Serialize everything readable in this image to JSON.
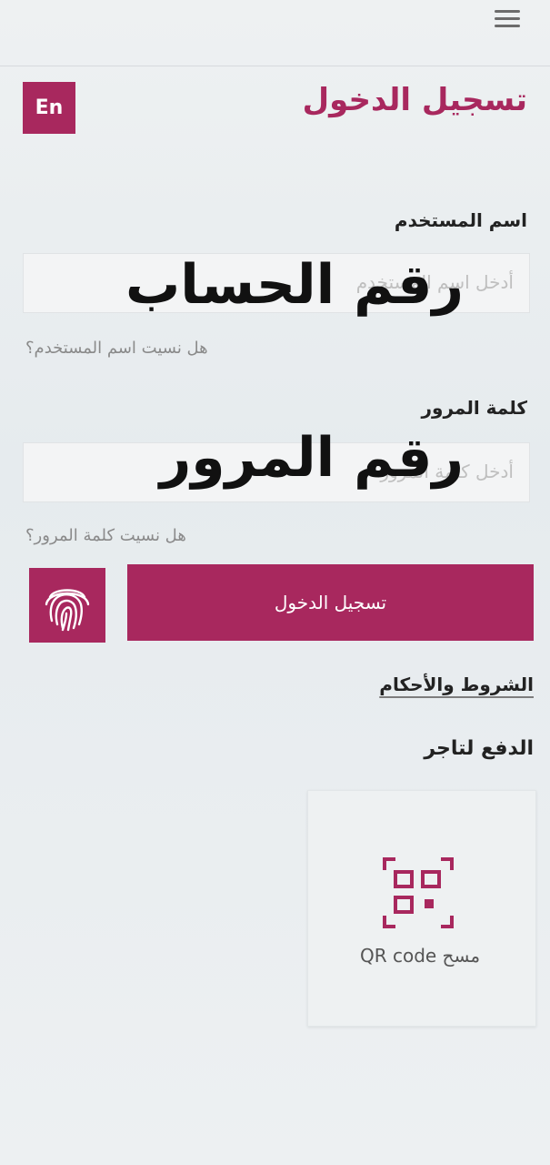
{
  "header": {
    "menu_icon": "hamburger-menu-icon",
    "title": "تسجيل الدخول",
    "lang_button": "En",
    "brand_color": "#a8285e"
  },
  "form": {
    "username": {
      "label": "اسم المستخدم",
      "placeholder": "أدخل اسم المستخدم",
      "overlay_text": "رقم الحساب",
      "forgot_link": "هل نسيت اسم المستخدم؟"
    },
    "password": {
      "label": "كلمة المرور",
      "placeholder": "أدخل كلمة المرور",
      "overlay_text": "رقم المرور",
      "forgot_link": "هل نسيت كلمة المرور؟"
    },
    "login_button": "تسجيل الدخول",
    "fingerprint_icon": "fingerprint-icon"
  },
  "links": {
    "terms": "الشروط والأحكام"
  },
  "payment": {
    "title": "الدفع لتاجر",
    "qr_label": "مسح QR code",
    "qr_icon": "qr-scan-icon"
  }
}
